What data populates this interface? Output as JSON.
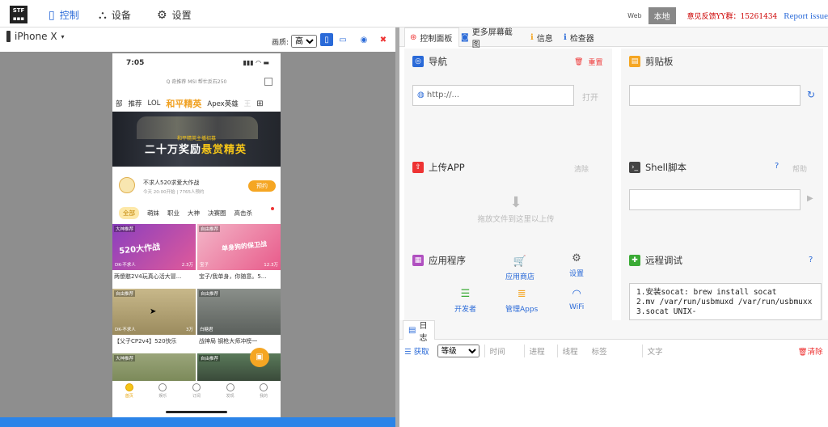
{
  "topbar": {
    "logo_text": "STF",
    "nav": [
      {
        "label": "控制",
        "icon": "phone-icon",
        "color": "#2a6ad8"
      },
      {
        "label": "设备",
        "icon": "sitemap-icon",
        "color": "#333333"
      },
      {
        "label": "设置",
        "icon": "gears-icon",
        "color": "#333333"
      }
    ],
    "web_label": "Web",
    "local_label": "本地",
    "feedback": "意见反馈YY群：15261434",
    "report": "Report issue"
  },
  "device": {
    "name": "iPhone X",
    "quality_label": "画质:",
    "quality_value": "高",
    "phone": {
      "time": "7:05",
      "search_text": "Q 奇推荐  MSI  帮忙反石250",
      "tabs": [
        "部",
        "推荐",
        "LOL",
        "和平精英",
        "Apex英雄",
        "王"
      ],
      "highlight_tab": "和平精英",
      "banner_small": "和平精英主播招募",
      "banner_main_a": "二十万奖励",
      "banner_main_b": "悬赏精英",
      "notice_title": "不求人520求爱大作战",
      "notice_sub": "今天 20:00开始 | 7765人预约",
      "notice_button": "预约",
      "subtabs": [
        "全部",
        "萌妹",
        "职业",
        "大神",
        "决赛圈",
        "高击杀"
      ],
      "cards": [
        {
          "tag": "大神推荐",
          "big": "520大作战",
          "meta": "DK-不求人",
          "right": "2.3万",
          "caption": "两傻憨2V4玩真心活大冒..."
        },
        {
          "tag": "自由推荐",
          "big": "单身狗的保卫战",
          "meta": "宝子",
          "right": "12.3万",
          "caption": "宝子/我单身，你随意。5..."
        },
        {
          "tag": "自由推荐",
          "big": "",
          "meta": "DK-不求人",
          "right": "3万",
          "caption": "【父子CP2v4】520快乐"
        },
        {
          "tag": "自由推荐",
          "big": "",
          "meta": "白糖君",
          "right": "",
          "caption": "战神局 钢枪大师冲榜一"
        },
        {
          "tag": "大神推荐",
          "big": "",
          "meta": "",
          "right": "",
          "caption": ""
        },
        {
          "tag": "自由推荐",
          "big": "",
          "meta": "",
          "right": "",
          "caption": ""
        }
      ],
      "bottom_nav": [
        "首页",
        "娱乐",
        "订阅",
        "发现",
        "我的"
      ]
    }
  },
  "right": {
    "tabs": [
      "控制面板",
      "更多屏幕截图",
      "信息",
      "检查器"
    ],
    "nav": {
      "title": "导航",
      "reset": "重置",
      "url_placeholder": "http://...",
      "open": "打开"
    },
    "clipboard": {
      "title": "剪贴板"
    },
    "upload": {
      "title": "上传APP",
      "clear": "清除",
      "drop_text": "拖放文件到这里以上传"
    },
    "shell": {
      "title": "Shell脚本",
      "help": "帮助"
    },
    "apps": {
      "title": "应用程序",
      "items": [
        "应用商店",
        "设置",
        "开发者",
        "管理Apps",
        "WiFi"
      ]
    },
    "remote": {
      "title": "远程调试",
      "code": "1.安装socat: brew install socat\n2.mv /var/run/usbmuxd /var/run/usbmuxx\n3.socat UNIX-"
    },
    "log": {
      "tab": "日志",
      "fetch": "获取",
      "level": "等级",
      "cols": [
        "时间",
        "进程",
        "线程",
        "标签",
        "文字"
      ],
      "clear": "清除"
    }
  },
  "colors": {
    "accent": "#2a6ad8",
    "nav_blue": "#2b84e8",
    "orange": "#f5a623",
    "red": "#e33333",
    "green": "#3aaa35",
    "purple": "#b050c0"
  }
}
